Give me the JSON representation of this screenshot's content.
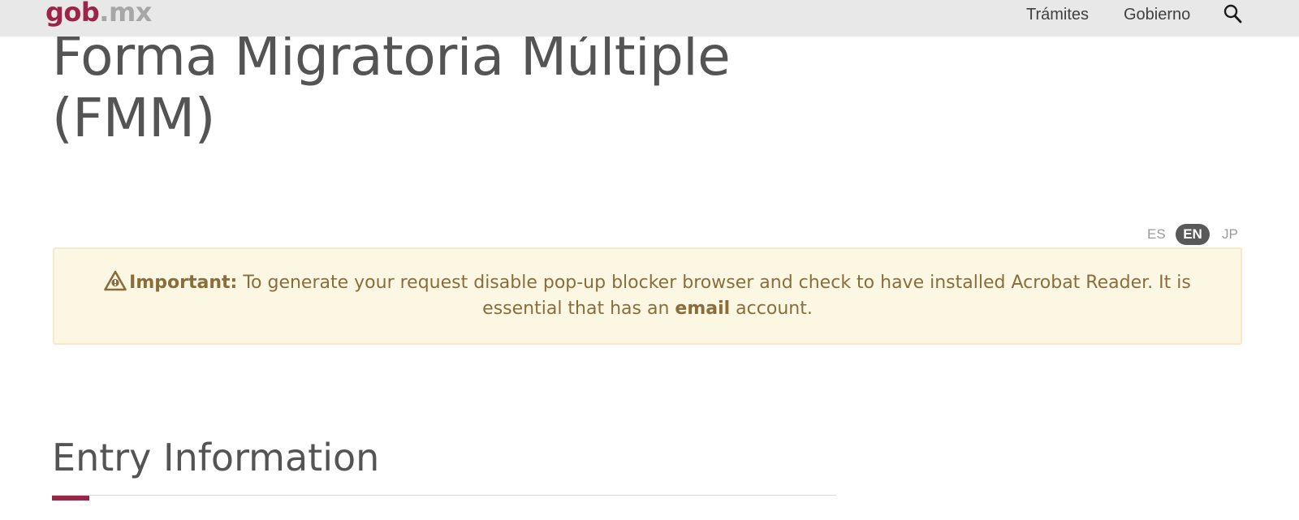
{
  "header": {
    "logo_gob": "gob",
    "logo_mx": ".mx",
    "nav": {
      "tramites": "Trámites",
      "gobierno": "Gobierno"
    },
    "search_icon": "search-icon"
  },
  "page": {
    "title": "Forma Migratoria Múltiple (FMM)"
  },
  "languages": {
    "es": "ES",
    "en": "EN",
    "jp": "JP",
    "active": "EN"
  },
  "alert": {
    "icon": "warning-icon",
    "label": "Important:",
    "text_before": " To generate your request disable pop-up blocker browser and check to have installed Acrobat Reader. It is essential that has an ",
    "emphasis": "email",
    "text_after": " account.",
    "colors": {
      "background": "#fcf7e3",
      "text": "#8a6d3b"
    }
  },
  "section": {
    "title": "Entry Information"
  },
  "colors": {
    "brand": "#9d2449",
    "topbar": "#e8e8e8"
  }
}
